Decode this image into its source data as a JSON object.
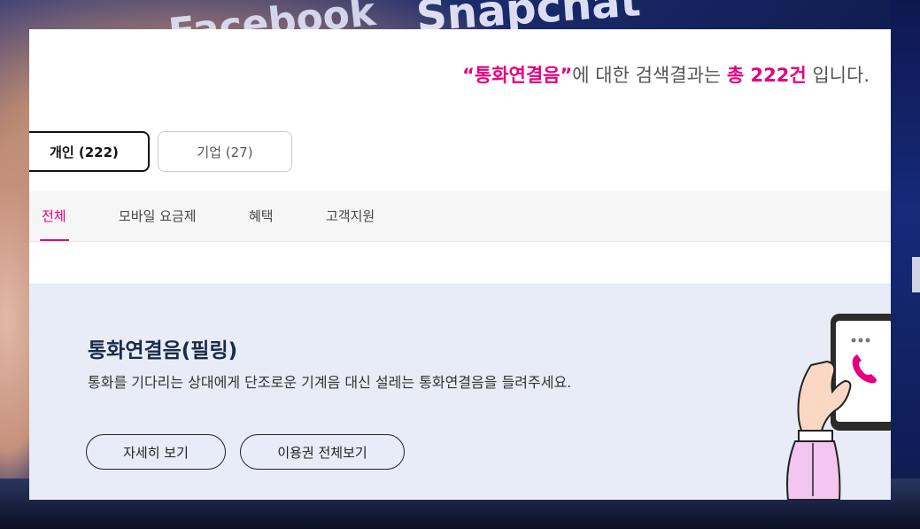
{
  "background": {
    "app_name_1": "Facebook",
    "app_name_2": "Snapchat"
  },
  "search": {
    "quote_open": "“",
    "query": "통화연결음",
    "quote_close": "”",
    "mid_text": "에 대한 검색결과는 ",
    "total_text": "총 222건",
    "end_text": " 입니다."
  },
  "segments": [
    {
      "label": "개인 (222)",
      "selected": true
    },
    {
      "label": "기업 (27)",
      "selected": false
    }
  ],
  "filters": [
    {
      "label": "전체",
      "active": true
    },
    {
      "label": "모바일 요금제",
      "active": false
    },
    {
      "label": "혜택",
      "active": false
    },
    {
      "label": "고객지원",
      "active": false
    }
  ],
  "card": {
    "title": "통화연결음(필링)",
    "description": "통화를 기다리는 상대에게 단조로운 기계음 대신 설레는 통화연결음을 들려주세요.",
    "button_detail": "자세히 보기",
    "button_all": "이용권 전체보기"
  },
  "colors": {
    "accent": "#e6007e",
    "card_bg": "#e8ecf6",
    "title": "#1a2a4a"
  }
}
